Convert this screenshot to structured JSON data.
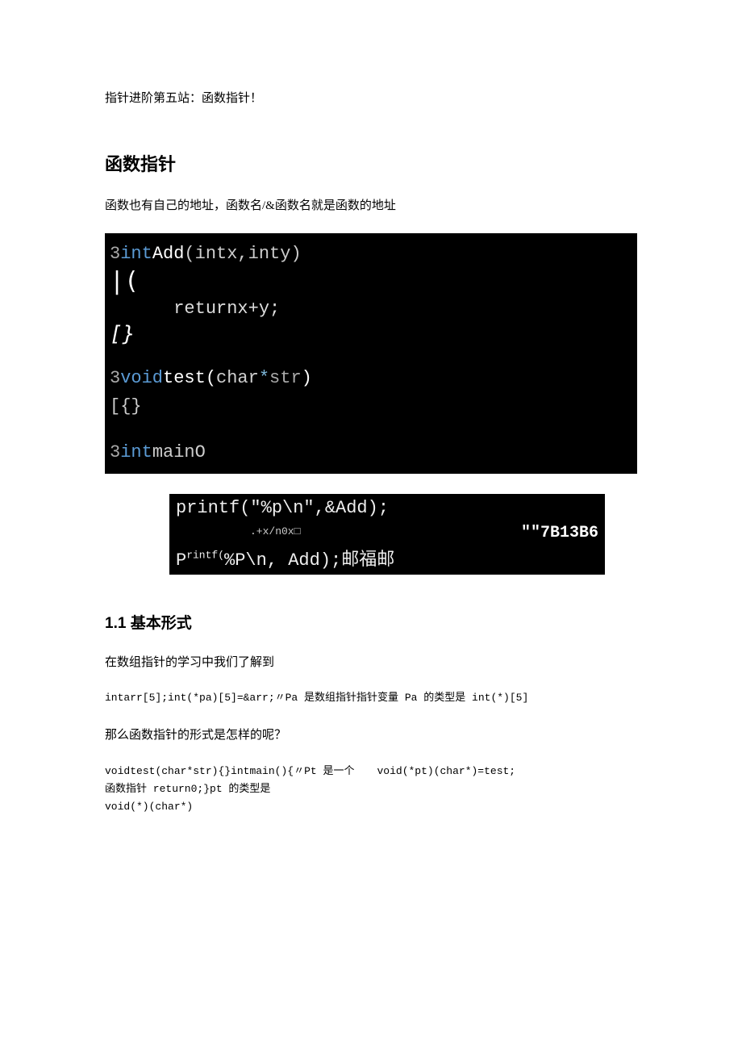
{
  "intro": "指针进阶第五站：函数指针！",
  "heading1": "函数指针",
  "para1": "函数也有自己的地址，函数名/&函数名就是函数的地址",
  "code1": {
    "l1_prefix": "3",
    "l1_int": "int",
    "l1_fn": "Add",
    "l1_args": "(intx,inty)",
    "l2": "|(",
    "l3_indent": "      ",
    "l3_return": "returnx+y;",
    "l4": "[}",
    "l5_prefix": "3",
    "l5_void": "void",
    "l5_fn": "test",
    "l5_paren_open": "(",
    "l5_char": "char",
    "l5_star": "*",
    "l5_str": "str",
    "l5_paren_close": ")",
    "l6": "[{}",
    "l7_prefix": "3",
    "l7_int": "int",
    "l7_main": "mainO"
  },
  "code2": {
    "r1": "printf(\"%p\\n\",&Add);",
    "r2_left": ".+x/n0x□",
    "r2_right": "\"\"7B13B6",
    "r3_p": "P",
    "r3_rintf": "rintf(",
    "r3_mid": "%P\\n, Add);",
    "r3_cn": "邮福邮"
  },
  "heading2": "1.1 基本形式",
  "para2": "在数组指针的学习中我们了解到",
  "code3": "intarr[5];int(*pa)[5]=&arr;〃Pa 是数组指针指针变量 Pa 的类型是 int(*)[5]",
  "para3": "那么函数指针的形式是怎样的呢？",
  "code4": {
    "left_l1_pre": "void",
    "left_l1_test": "test",
    "left_l1_post": "(char*str){}intmain(){〃Pt 是一个",
    "left_l2": "函数指针 return0;}pt 的类型是",
    "left_l3": "void(*)(char*)",
    "right_l1": "void(*pt)(char*)=test;"
  }
}
